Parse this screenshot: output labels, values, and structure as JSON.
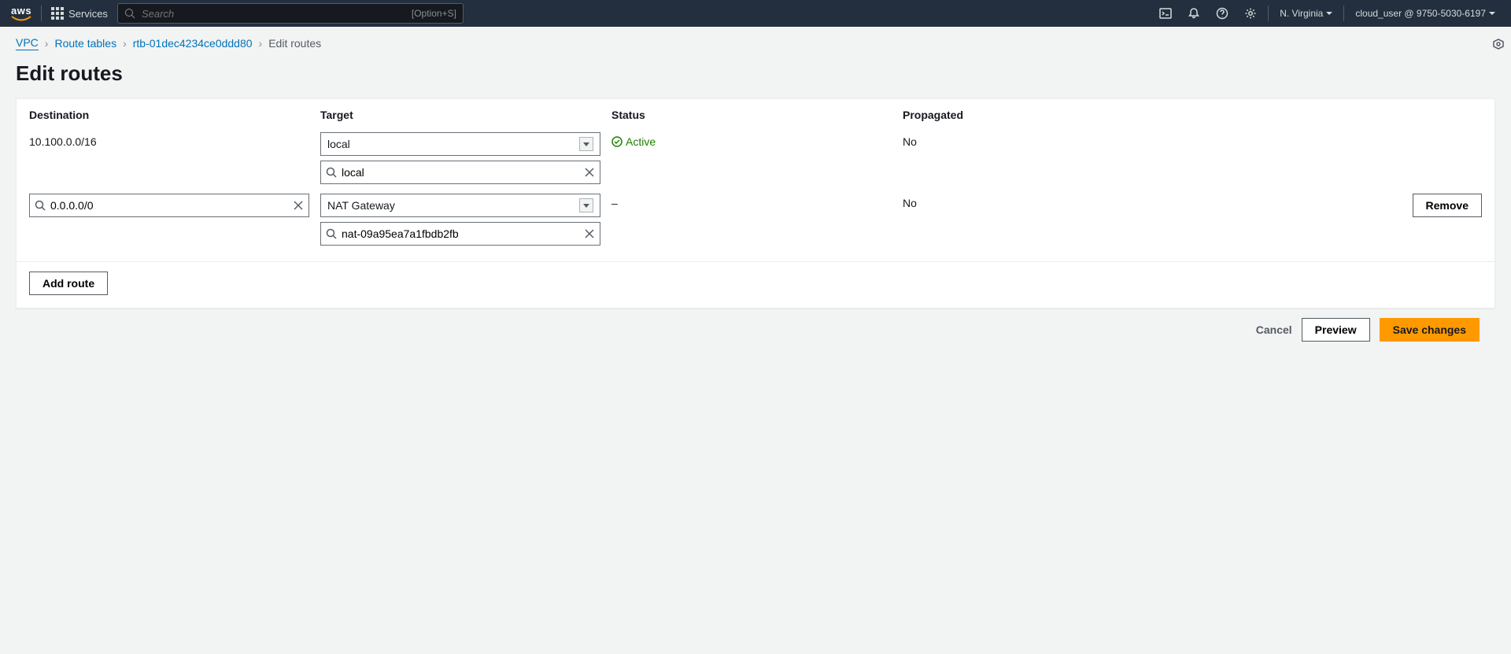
{
  "nav": {
    "services_label": "Services",
    "search_placeholder": "Search",
    "search_shortcut": "[Option+S]",
    "region": "N. Virginia",
    "account": "cloud_user @ 9750-5030-6197"
  },
  "breadcrumb": {
    "vpc": "VPC",
    "route_tables": "Route tables",
    "rtb_id": "rtb-01dec4234ce0ddd80",
    "current": "Edit routes"
  },
  "page_title": "Edit routes",
  "columns": {
    "destination": "Destination",
    "target": "Target",
    "status": "Status",
    "propagated": "Propagated"
  },
  "rows": {
    "r1": {
      "destination": "10.100.0.0/16",
      "target_select": "local",
      "target_search": "local",
      "status": "Active",
      "propagated": "No"
    },
    "r2": {
      "destination_value": "0.0.0.0/0",
      "target_select": "NAT Gateway",
      "target_search": "nat-09a95ea7a1fbdb2fb",
      "status": "–",
      "propagated": "No"
    }
  },
  "buttons": {
    "add_route": "Add route",
    "remove": "Remove",
    "cancel": "Cancel",
    "preview": "Preview",
    "save": "Save changes"
  }
}
